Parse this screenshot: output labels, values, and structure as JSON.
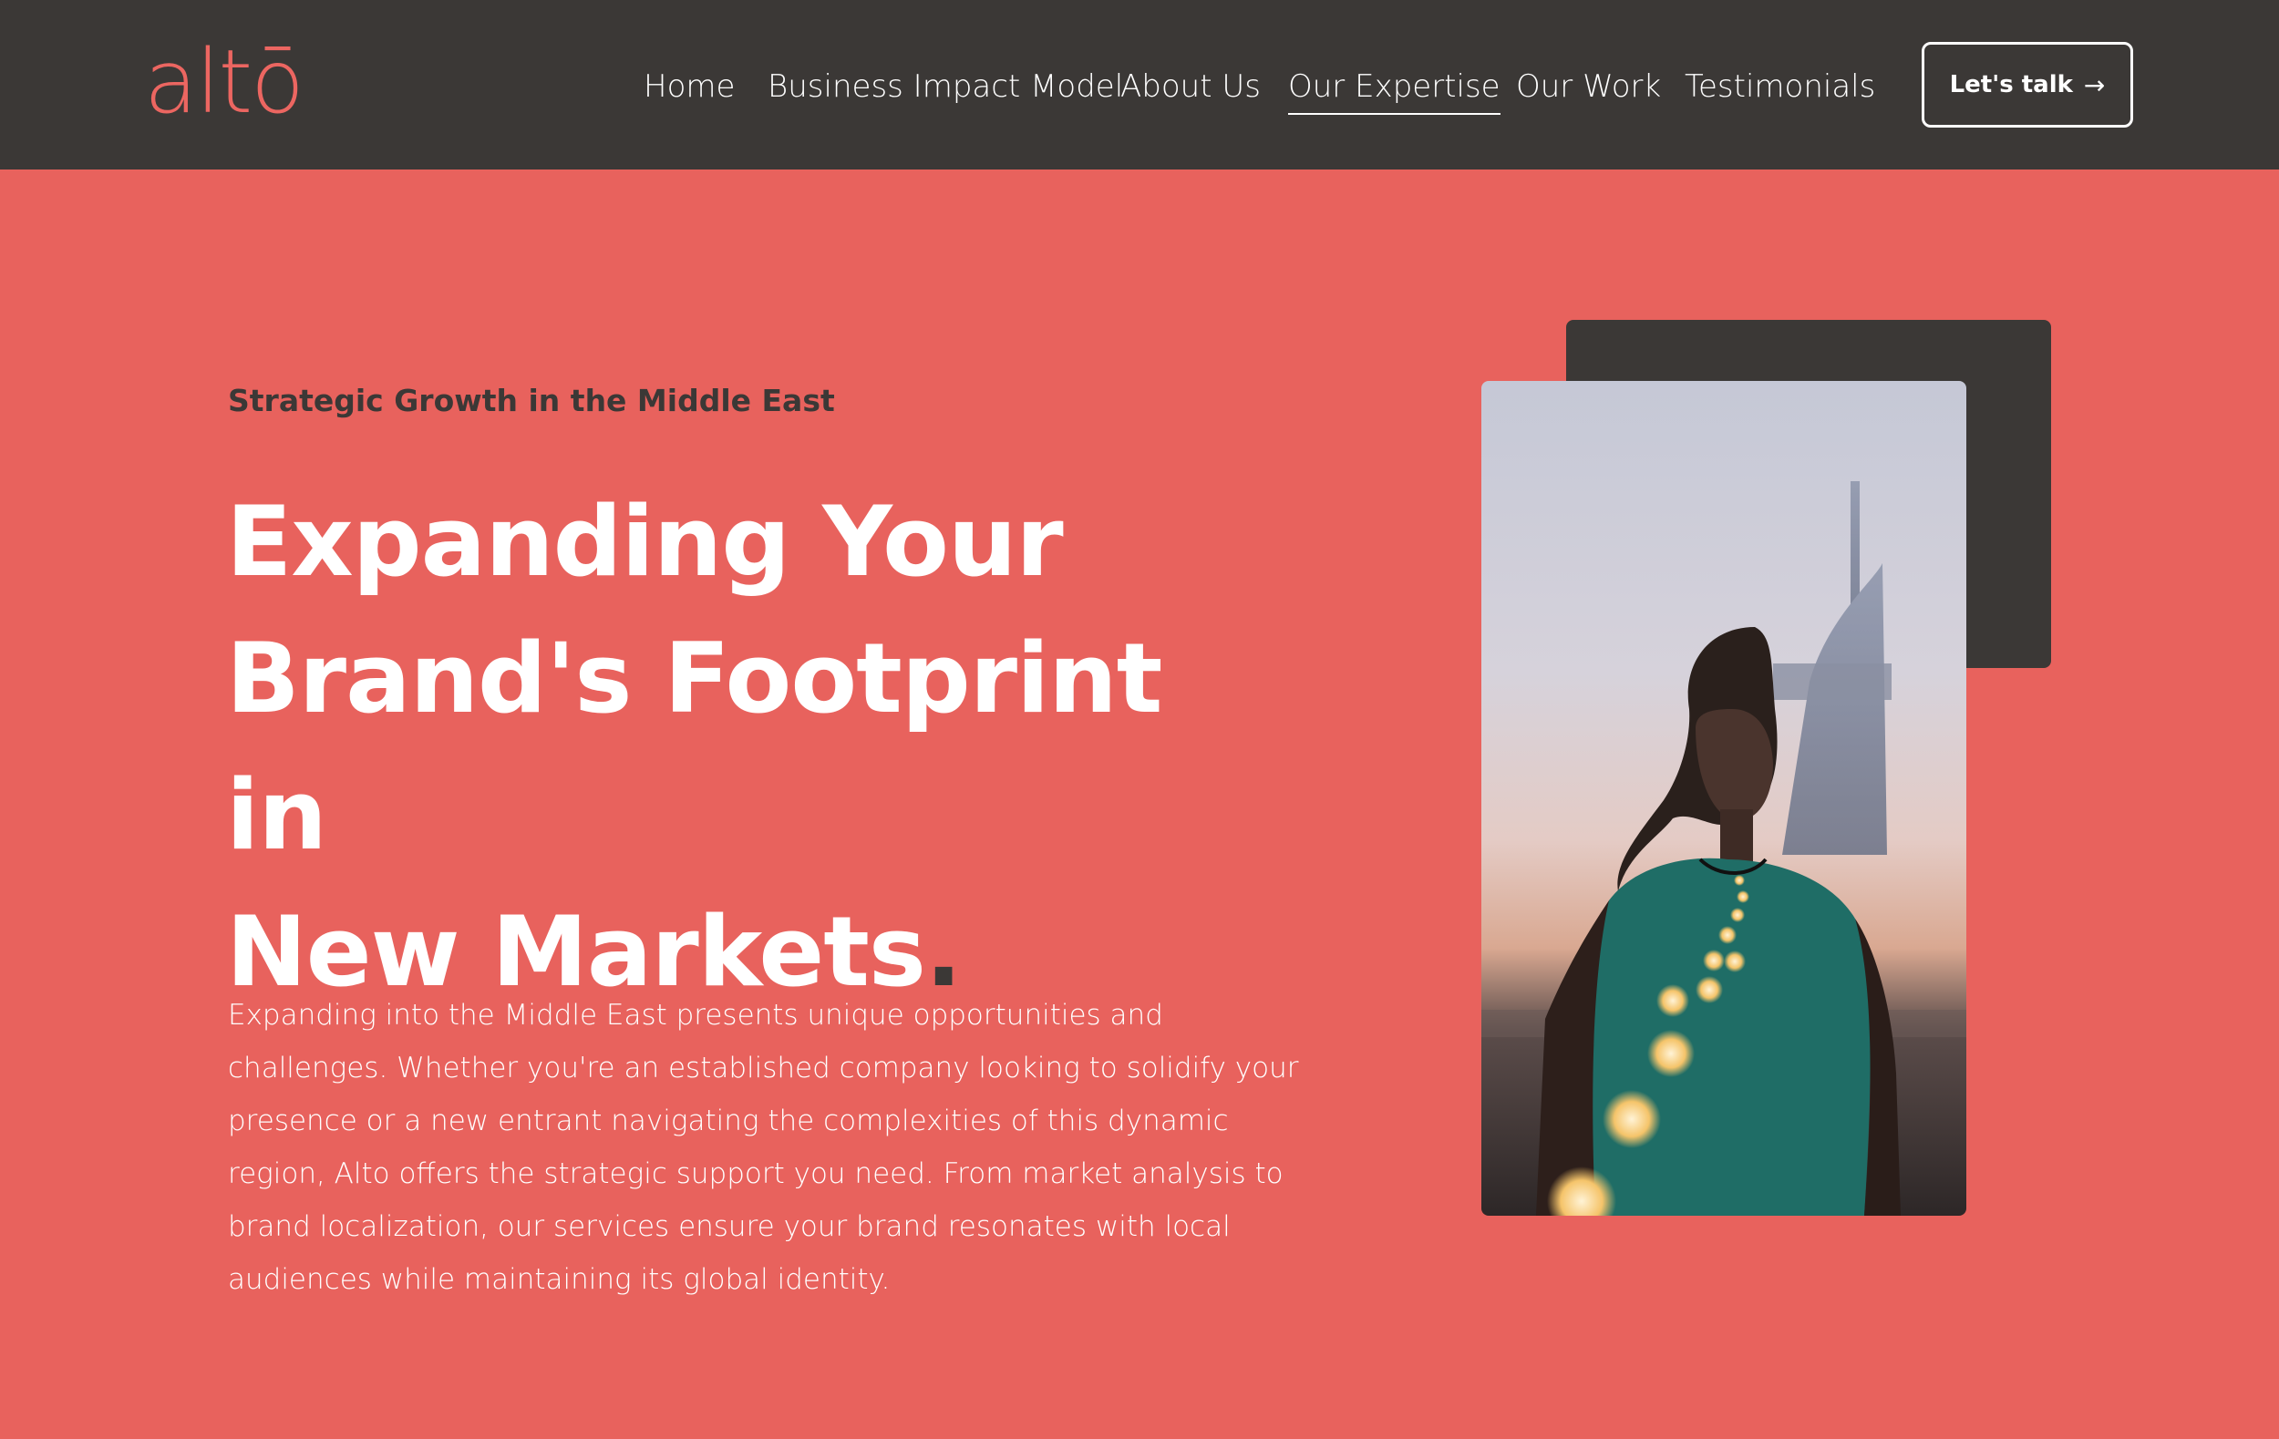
{
  "header": {
    "logo_text": "altō",
    "nav": [
      {
        "label": "Home",
        "active": false
      },
      {
        "label": "Business Impact Model",
        "active": false
      },
      {
        "label": "About Us",
        "active": false
      },
      {
        "label": "Our Expertise",
        "active": true
      },
      {
        "label": "Our Work",
        "active": false
      },
      {
        "label": "Testimonials",
        "active": false
      }
    ],
    "cta_label": "Let's talk",
    "cta_icon": "arrow-right-icon"
  },
  "hero": {
    "eyebrow": "Strategic Growth in the Middle East",
    "headline_lines": [
      "Expanding Your",
      "Brand's Footprint in",
      "New Markets"
    ],
    "headline_dot": ".",
    "body": "Expanding into the Middle East presents unique opportunities and challenges. Whether you're an established company looking to solidify your presence or a new entrant navigating the complexities of this dynamic region, Alto offers the strategic support you need. From market analysis to brand localization, our services ensure your brand resonates with local audiences while maintaining its global identity."
  },
  "colors": {
    "brand_coral": "#e8625d",
    "dark": "#3b3836",
    "text_light": "#ffffff"
  }
}
